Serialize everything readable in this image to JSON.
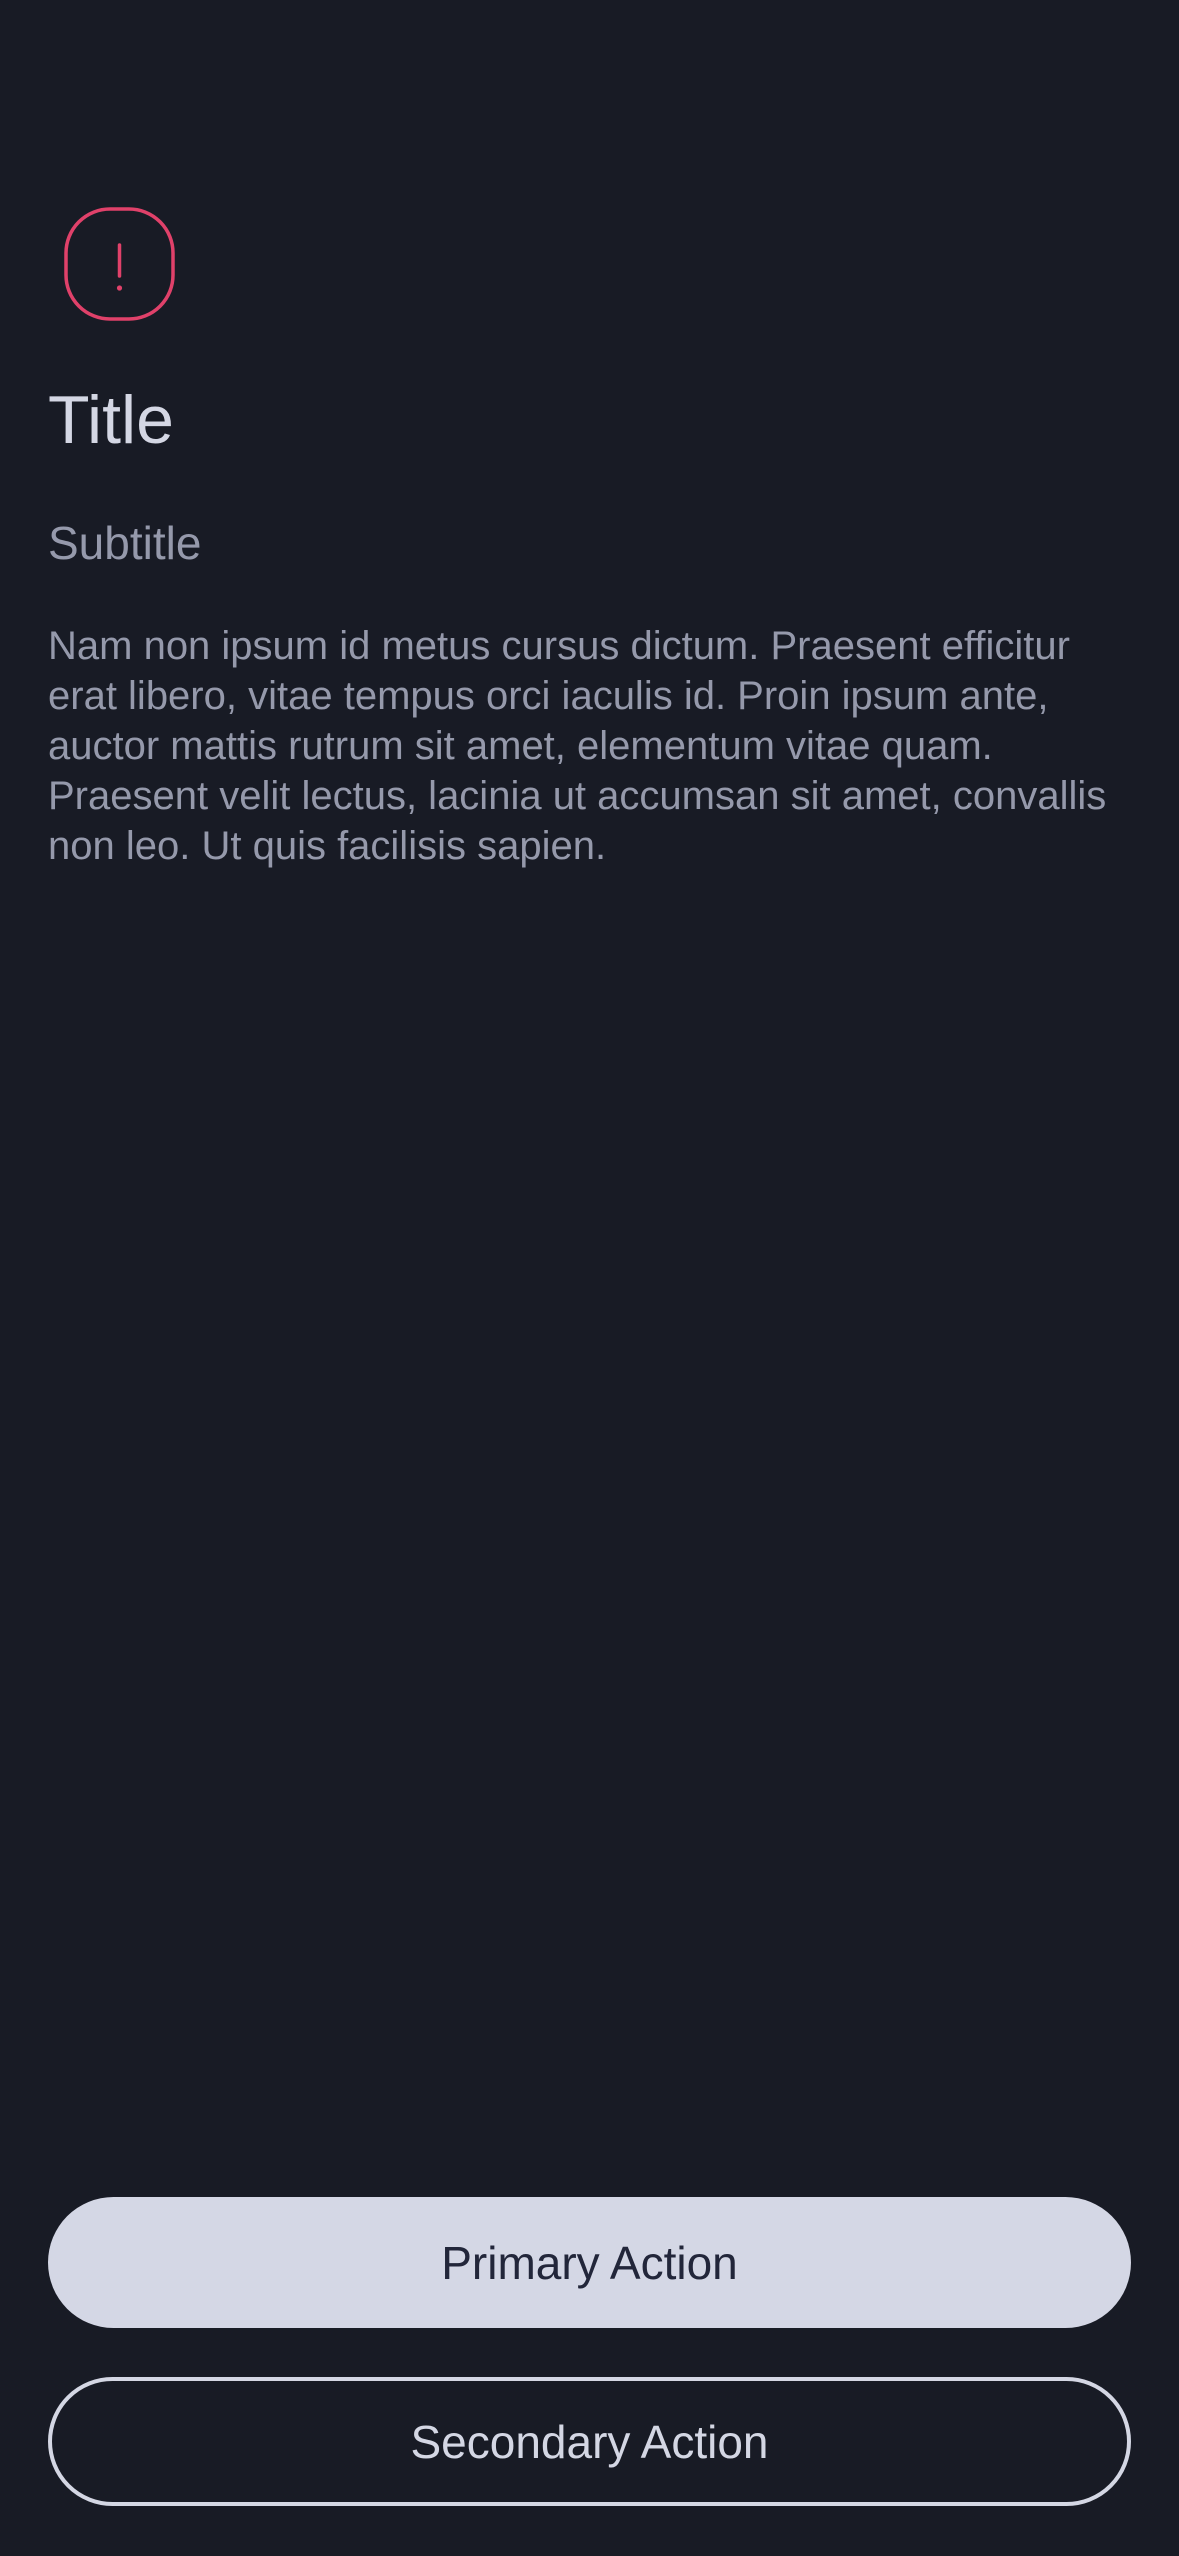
{
  "icon": {
    "name": "alert-icon",
    "color": "#e0416a"
  },
  "content": {
    "title": "Title",
    "subtitle": "Subtitle",
    "body": "Nam non ipsum id metus cursus dictum. Praesent efficitur erat libero, vitae tempus orci iaculis id. Proin ipsum ante, auctor mattis rutrum sit amet, elementum vitae quam. Praesent velit lectus, lacinia ut accumsan sit amet, convallis non leo. Ut quis facilisis sapien."
  },
  "actions": {
    "primary_label": "Primary Action",
    "secondary_label": "Secondary Action"
  },
  "colors": {
    "background": "#181b25",
    "text_primary": "#d4d7e4",
    "text_secondary": "#9599ab",
    "accent": "#e0416a"
  }
}
